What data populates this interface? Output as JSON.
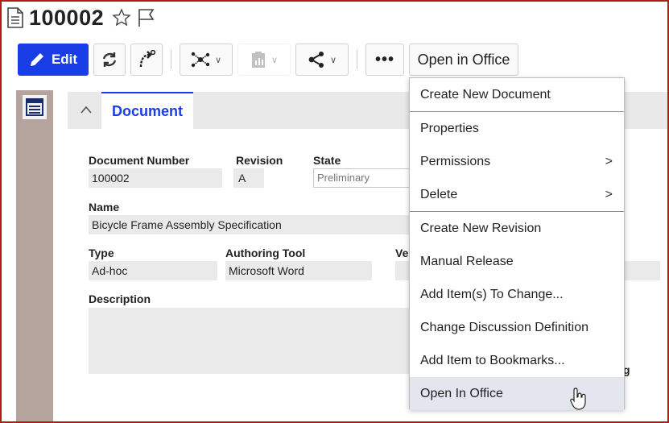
{
  "header": {
    "title": "100002"
  },
  "toolbar": {
    "edit_label": "Edit",
    "more_label": "•••",
    "open_in_office_label": "Open in Office"
  },
  "tabs": {
    "collapse_glyph": "^",
    "active_tab": "Document"
  },
  "form": {
    "document_number_label": "Document Number",
    "document_number_value": "100002",
    "revision_label": "Revision",
    "revision_value": "A",
    "state_label": "State",
    "state_value": "Preliminary",
    "name_label": "Name",
    "name_value": "Bicycle Frame Assembly Specification",
    "type_label": "Type",
    "type_value": "Ad-hoc",
    "authoring_tool_label": "Authoring Tool",
    "authoring_tool_value": "Microsoft Word",
    "partial_ve_label": "Ve",
    "description_label": "Description",
    "partial_g_label": "g"
  },
  "menu": {
    "items": [
      {
        "label": "Create New Document",
        "arrow": ""
      },
      {
        "label": "Properties",
        "arrow": ""
      },
      {
        "label": "Permissions",
        "arrow": ">"
      },
      {
        "label": "Delete",
        "arrow": ">"
      },
      {
        "label": "Create New Revision",
        "arrow": ""
      },
      {
        "label": "Manual Release",
        "arrow": ""
      },
      {
        "label": "Add Item(s) To Change...",
        "arrow": ""
      },
      {
        "label": "Change Discussion Definition",
        "arrow": ""
      },
      {
        "label": "Add Item to Bookmarks...",
        "arrow": ""
      },
      {
        "label": "Open In Office",
        "arrow": ""
      }
    ]
  },
  "icons": {
    "doc": "document-icon",
    "star": "star-outline-icon",
    "flag": "flag-outline-icon",
    "edit": "pencil-icon",
    "refresh": "refresh-icon",
    "promote": "curved-arrow-icon",
    "structure": "structure-network-icon",
    "report": "report-icon",
    "share": "share-icon",
    "form": "form-view-icon",
    "cursor": "hand-pointer-icon"
  },
  "colors": {
    "accent": "#1a3ee6",
    "frame": "#b31b1b",
    "rail": "#b5a49d",
    "highlight": "#e3e6ef"
  }
}
